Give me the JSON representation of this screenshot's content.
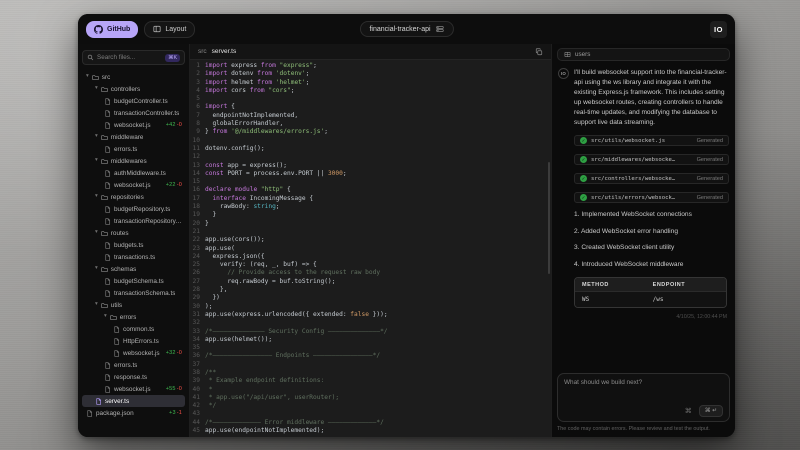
{
  "topbar": {
    "github_label": "GitHub",
    "layout_label": "Layout",
    "project_name": "financial-tracker-api",
    "logo_text": "IO"
  },
  "sidebar": {
    "search": {
      "placeholder": "Search files...",
      "shortcut": "⌘K"
    },
    "tree": [
      {
        "type": "folder",
        "name": "src",
        "depth": 0
      },
      {
        "type": "folder",
        "name": "controllers",
        "depth": 1
      },
      {
        "type": "file",
        "name": "budgetController.ts",
        "depth": 2
      },
      {
        "type": "file",
        "name": "transactionController.ts",
        "depth": 2
      },
      {
        "type": "file",
        "name": "websocket.js",
        "depth": 2,
        "add": "+42",
        "del": "-0"
      },
      {
        "type": "folder",
        "name": "middleware",
        "depth": 1
      },
      {
        "type": "file",
        "name": "errors.ts",
        "depth": 2
      },
      {
        "type": "folder",
        "name": "middlewares",
        "depth": 1
      },
      {
        "type": "file",
        "name": "authMiddleware.ts",
        "depth": 2
      },
      {
        "type": "file",
        "name": "websocket.js",
        "depth": 2,
        "add": "+22",
        "del": "-0"
      },
      {
        "type": "folder",
        "name": "repositories",
        "depth": 1
      },
      {
        "type": "file",
        "name": "budgetRepository.ts",
        "depth": 2
      },
      {
        "type": "file",
        "name": "transactionRepository.ts",
        "depth": 2
      },
      {
        "type": "folder",
        "name": "routes",
        "depth": 1
      },
      {
        "type": "file",
        "name": "budgets.ts",
        "depth": 2
      },
      {
        "type": "file",
        "name": "transactions.ts",
        "depth": 2
      },
      {
        "type": "folder",
        "name": "schemas",
        "depth": 1
      },
      {
        "type": "file",
        "name": "budgetSchema.ts",
        "depth": 2
      },
      {
        "type": "file",
        "name": "transactionSchema.ts",
        "depth": 2
      },
      {
        "type": "folder",
        "name": "utils",
        "depth": 1
      },
      {
        "type": "folder",
        "name": "errors",
        "depth": 2
      },
      {
        "type": "file",
        "name": "common.ts",
        "depth": 3
      },
      {
        "type": "file",
        "name": "HttpErrors.ts",
        "depth": 3
      },
      {
        "type": "file",
        "name": "websocket.js",
        "depth": 3,
        "add": "+32",
        "del": "-0"
      },
      {
        "type": "file",
        "name": "errors.ts",
        "depth": 2
      },
      {
        "type": "file",
        "name": "response.ts",
        "depth": 2
      },
      {
        "type": "file",
        "name": "websocket.js",
        "depth": 2,
        "add": "+55",
        "del": "-0"
      },
      {
        "type": "file",
        "name": "server.ts",
        "depth": 1,
        "selected": true
      },
      {
        "type": "file",
        "name": "package.json",
        "depth": 0,
        "add": "+3",
        "del": "-1"
      }
    ]
  },
  "editor": {
    "breadcrumb": {
      "dir": "src",
      "file": "server.ts"
    },
    "lines": [
      "import express from \"express\";",
      "import dotenv from 'dotenv';",
      "import helmet from 'helmet';",
      "import cors from \"cors\";",
      "",
      "import {",
      "  endpointNotImplemented,",
      "  globalErrorHandler,",
      "} from '@/middlewares/errors.js';",
      "",
      "dotenv.config();",
      "",
      "const app = express();",
      "const PORT = process.env.PORT || 3000;",
      "",
      "declare module \"http\" {",
      "  interface IncomingMessage {",
      "    rawBody: string;",
      "  }",
      "}",
      "",
      "app.use(cors());",
      "app.use(",
      "  express.json({",
      "    verify: (req, _, buf) => {",
      "      // Provide access to the request raw body",
      "      req.rawBody = buf.toString();",
      "    },",
      "  })",
      ");",
      "app.use(express.urlencoded({ extended: false }));",
      "",
      "/*—————————————— Security Config ——————————————*/",
      "app.use(helmet());",
      "",
      "/*———————————————— Endpoints ————————————————*/",
      "",
      "/**",
      " * Example endpoint definitions:",
      " *",
      " * app.use(\"/api/user\", userRouter);",
      " */",
      "",
      "/*————————————— Error middleware —————————————*/",
      "app.use(endpointNotImplemented);"
    ]
  },
  "chat": {
    "tab_label": "users",
    "avatar_text": "IO",
    "message": "I'll build websocket support into the financial-tracker-api using the ws library and integrate it with the existing Express.js framework. This includes setting up websocket routes, creating controllers to handle real-time updates, and modifying the database to support live data streaming.",
    "generated_files": [
      {
        "path": "src/utils/websocket.js",
        "status": "Generated"
      },
      {
        "path": "src/middlewares/websocke…",
        "status": "Generated"
      },
      {
        "path": "src/controllers/websocke…",
        "status": "Generated"
      },
      {
        "path": "src/utils/errors/websock…",
        "status": "Generated"
      }
    ],
    "steps": [
      "Implemented WebSocket connections",
      "Added WebSocket error handling",
      "Created WebSocket client utility",
      "Introduced WebSocket middleware"
    ],
    "table": {
      "headers": [
        "METHOD",
        "ENDPOINT"
      ],
      "rows": [
        [
          "WS",
          "/ws"
        ]
      ]
    },
    "timestamp": "4/10/25, 12:00:44 PM",
    "input": {
      "placeholder": "What should we build next?",
      "send_shortcut": "⌘ ↵"
    },
    "disclaimer": "The code may contain errors. Please review and test the output."
  },
  "icons": {
    "chevron": "▾",
    "check": "✓",
    "command": "⌘"
  },
  "colors": {
    "accent": "#b7a5f8",
    "added": "#3fb950",
    "removed": "#f85149",
    "generated_check": "#2ea043"
  }
}
